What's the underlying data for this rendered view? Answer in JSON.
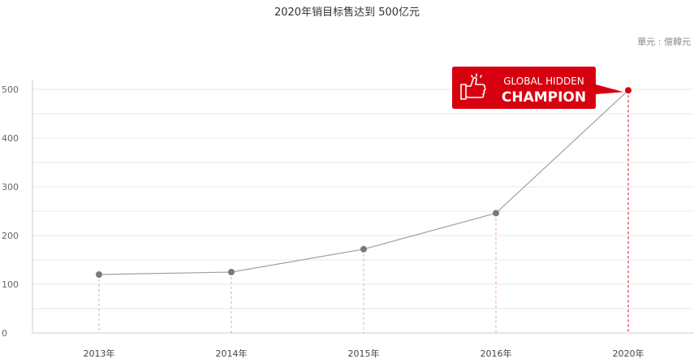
{
  "chart_data": {
    "type": "line",
    "title": "2020年销目标售达到 500亿元",
    "unit": "單元 : 億韓元",
    "categories": [
      "2013年",
      "2014年",
      "2015年",
      "2016年",
      "2020年"
    ],
    "values": [
      120,
      125,
      172,
      246,
      498
    ],
    "ylim": [
      0,
      500
    ],
    "yticks": [
      0,
      100,
      200,
      300,
      400,
      500
    ],
    "grid": true,
    "highlight_index": 4,
    "badge": {
      "line1": "GLOBAL HIDDEN",
      "line2": "CHAMPION"
    },
    "colors": {
      "line": "#a0a0a0",
      "marker": "#777a84",
      "highlight": "#d7000f",
      "grid": "#e8e8e8",
      "axis": "#cccccc",
      "dashed": "#e6a4a4"
    }
  }
}
